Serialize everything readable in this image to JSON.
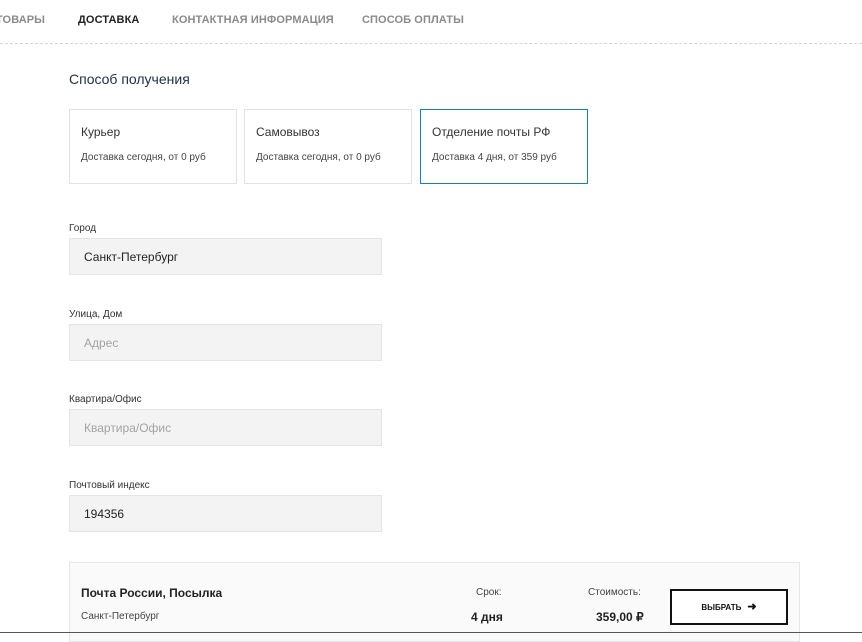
{
  "steps": {
    "goods": "ТОВАРЫ",
    "delivery": "ДОСТАВКА",
    "contact": "КОНТАКТНАЯ ИНФОРМАЦИЯ",
    "payment": "СПОСОБ ОПЛАТЫ",
    "active": "delivery"
  },
  "receipt": {
    "title": "Способ получения",
    "options": [
      {
        "name": "Курьер",
        "desc": "Доставка сегодня, от 0 руб",
        "selected": false
      },
      {
        "name": "Самовывоз",
        "desc": "Доставка сегодня, от 0 руб",
        "selected": false
      },
      {
        "name": "Отделение почты РФ",
        "desc": "Доставка 4 дня, от 359 руб",
        "selected": true
      }
    ]
  },
  "form": {
    "city": {
      "label": "Город",
      "value": "Санкт-Петербург",
      "placeholder": ""
    },
    "street": {
      "label": "Улица, Дом",
      "value": "",
      "placeholder": "Адрес"
    },
    "apartment": {
      "label": "Квартира/Офис",
      "value": "",
      "placeholder": "Квартира/Офис"
    },
    "zip": {
      "label": "Почтовый индекс",
      "value": "194356",
      "placeholder": ""
    }
  },
  "tariff": {
    "name": "Почта России, Посылка",
    "city": "Санкт-Петербург",
    "term_label": "Срок:",
    "term_value": "4 дня",
    "price_label": "Стоимость:",
    "price_value": "359,00 ₽",
    "button_label": "ВЫБРАТЬ",
    "button_icon": "arrow-right-icon"
  },
  "colors": {
    "accent": "#1a7fb5",
    "input_bg": "#f3f3f3",
    "title": "#1f2f45"
  }
}
